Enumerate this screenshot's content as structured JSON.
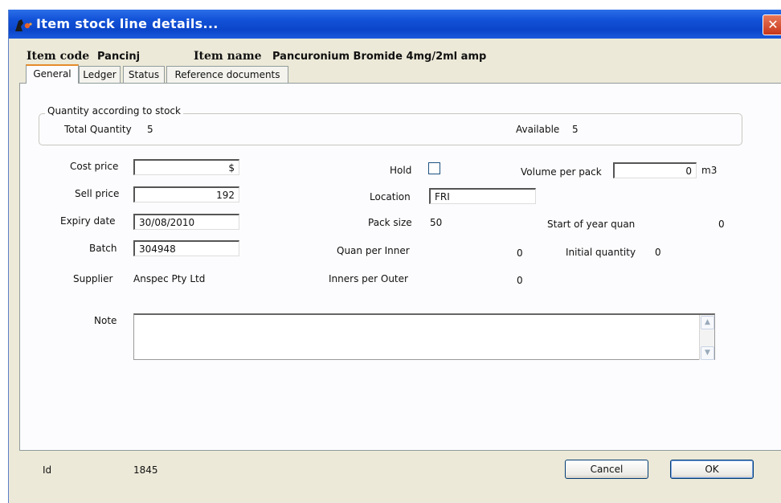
{
  "window": {
    "title": "Item stock line details..."
  },
  "header": {
    "item_code_label": "Item code",
    "item_code": "Pancinj",
    "item_name_label": "Item name",
    "item_name": "Pancuronium Bromide 4mg/2ml amp"
  },
  "tabs": [
    {
      "label": "General",
      "active": true
    },
    {
      "label": "Ledger",
      "active": false
    },
    {
      "label": "Status",
      "active": false
    },
    {
      "label": "Reference documents",
      "active": false
    }
  ],
  "quantity_group": {
    "legend": "Quantity according to stock",
    "total_label": "Total Quantity",
    "total_value": "5",
    "available_label": "Available",
    "available_value": "5"
  },
  "fields": {
    "cost_price": {
      "label": "Cost price",
      "value": "$"
    },
    "sell_price": {
      "label": "Sell price",
      "value": "192"
    },
    "expiry_date": {
      "label": "Expiry date",
      "value": "30/08/2010"
    },
    "batch": {
      "label": "Batch",
      "value": "304948"
    },
    "supplier": {
      "label": "Supplier",
      "value": "Anspec Pty Ltd"
    },
    "hold": {
      "label": "Hold",
      "checked": false
    },
    "location": {
      "label": "Location",
      "value": "FRI"
    },
    "pack_size": {
      "label": "Pack size",
      "value": "50"
    },
    "quan_per_inner": {
      "label": "Quan per Inner",
      "value": "0"
    },
    "inners_per_outer": {
      "label": "Inners per Outer",
      "value": "0"
    },
    "volume_per_pack": {
      "label": "Volume per pack",
      "value": "0",
      "unit": "m3"
    },
    "start_of_year_quan": {
      "label": "Start of year quan",
      "value": "0"
    },
    "initial_quantity": {
      "label": "Initial quantity",
      "value": "0"
    },
    "note": {
      "label": "Note",
      "value": ""
    }
  },
  "footer": {
    "id_label": "Id",
    "id_value": "1845",
    "cancel_label": "Cancel",
    "ok_label": "OK"
  },
  "colors": {
    "titlebar": "#0b45c9",
    "window_bg": "#ece9d8",
    "panel_bg": "#fcfcfe",
    "active_tab_accent": "#e68b2c",
    "close_button": "#c8361a"
  }
}
